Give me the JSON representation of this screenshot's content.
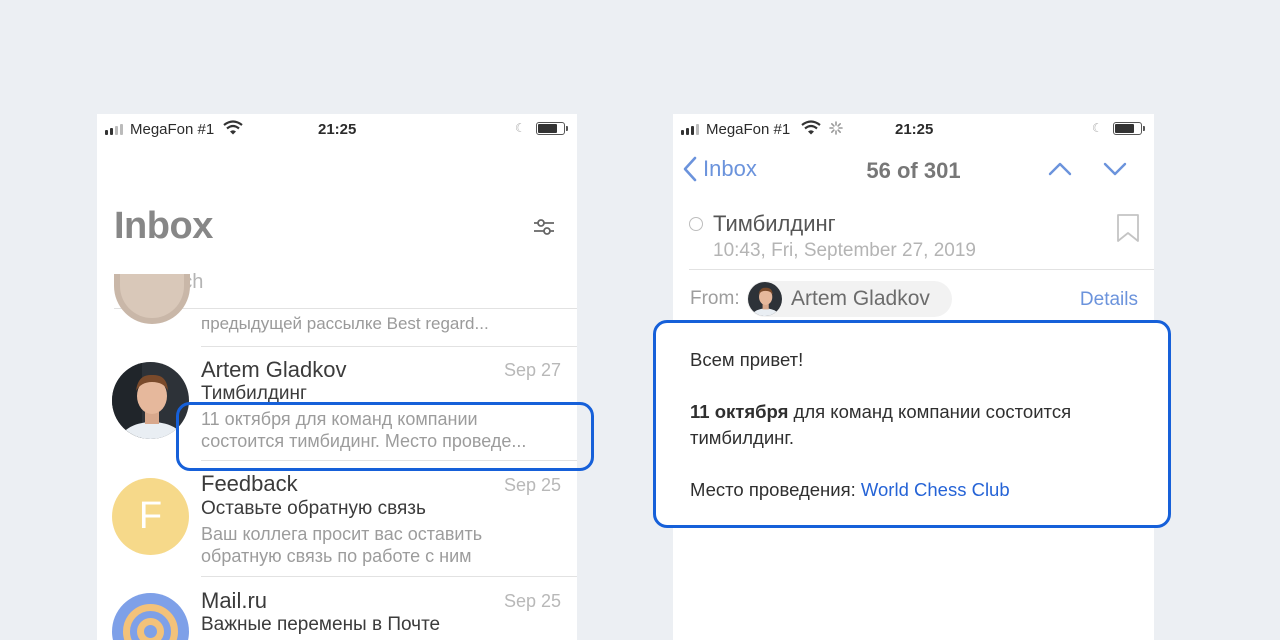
{
  "status_left": {
    "carrier": "MegaFon #1",
    "time": "21:25",
    "battery_level": 0.75
  },
  "status_right": {
    "carrier": "MegaFon #1",
    "time": "21:25",
    "battery_level": 0.75
  },
  "inbox": {
    "title": "Inbox",
    "search_placeholder": "Search",
    "partial_row_preview": "предыдущей рассылке Best regard...",
    "messages": [
      {
        "sender": "Artem Gladkov",
        "date": "Sep 27",
        "subject": "Тимбилдинг",
        "preview_line1": "11 октября для команд компании",
        "preview_line2": "состоится тимбидинг. Место проведе...",
        "avatar": "photo"
      },
      {
        "sender": "Feedback",
        "date": "Sep 25",
        "subject": "Оставьте обратную связь",
        "preview_line1": "Ваш коллега просит вас оставить",
        "preview_line2": "обратную связь по работе с ним",
        "avatar_letter": "F"
      },
      {
        "sender": "Mail.ru",
        "date": "Sep 25",
        "subject": "Важные перемены в Почте",
        "avatar": "at-sign"
      }
    ]
  },
  "message_view": {
    "back_label": "Inbox",
    "counter": "56 of 301",
    "subject": "Тимбилдинг",
    "datetime": "10:43, Fri, September 27, 2019",
    "from_label": "From:",
    "from_name": "Artem Gladkov",
    "details_label": "Details",
    "greeting": "Всем привет!",
    "date_bold": "11 октября",
    "body_rest": " для команд компании состоится",
    "body_line2": "тимбилдинг.",
    "venue_label": "Место проведения: ",
    "venue_link": "World Chess Club"
  },
  "colors": {
    "accent": "#1660d9",
    "link": "#6b93dc",
    "avatar_feedback": "#f6d98a",
    "avatar_mailru": "#7ea0e8"
  }
}
